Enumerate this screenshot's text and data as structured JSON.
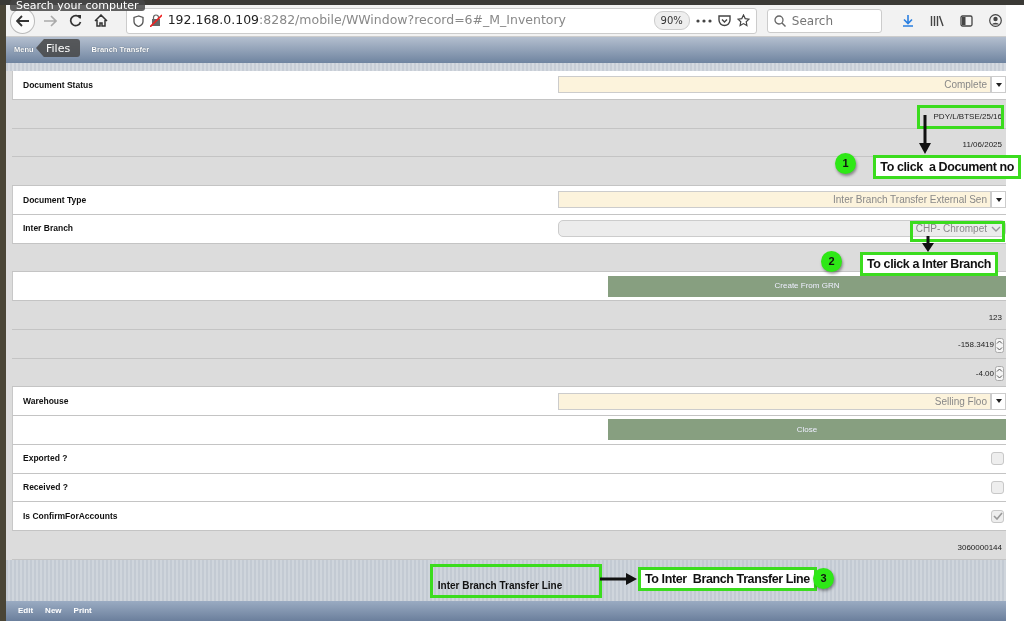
{
  "desktop_tooltips": [
    {
      "text": "Search your computer"
    },
    {
      "text": "Files"
    }
  ],
  "browser": {
    "url_host": "192.168.0.109",
    "url_rest": ":8282/mobile/WWindow?record=6#_M_Inventory",
    "zoom": "90%",
    "search": {
      "placeholder": "Search"
    }
  },
  "header": {
    "breadcrumb": [
      "Menu",
      "Branch Transfer"
    ]
  },
  "rows": [
    {
      "kind": "select",
      "label": "Document Status",
      "value": "Complete",
      "disabled": false
    },
    {
      "kind": "text",
      "value": "PDY/L/BTSE/25/16"
    },
    {
      "kind": "text",
      "value": "11/06/2025"
    },
    {
      "kind": "empty"
    },
    {
      "kind": "select",
      "label": "Document Type",
      "value": "Inter Branch Transfer External Sen",
      "disabled": false
    },
    {
      "kind": "select",
      "label": "Inter Branch",
      "value": "CHP- Chrompet",
      "disabled": true
    },
    {
      "kind": "empty"
    },
    {
      "kind": "button",
      "label": "Create From GRN"
    },
    {
      "kind": "text",
      "value": "123"
    },
    {
      "kind": "number",
      "value": "-158.3419"
    },
    {
      "kind": "number",
      "value": "-4.00"
    },
    {
      "kind": "select",
      "label": "Warehouse",
      "value": "Selling Floo",
      "disabled": false
    },
    {
      "kind": "button",
      "label": "Close"
    },
    {
      "kind": "checkbox",
      "label": "Exported ?",
      "checked": false
    },
    {
      "kind": "checkbox",
      "label": "Received ?",
      "checked": false
    },
    {
      "kind": "checkbox",
      "label": "Is ConfirmForAccounts",
      "checked": true
    },
    {
      "kind": "text",
      "value": "3060000144"
    }
  ],
  "tab": {
    "label": "Inter Branch Transfer Line"
  },
  "footer": {
    "actions": [
      "Edit",
      "New",
      "Print"
    ]
  },
  "annotations": [
    {
      "number": "1",
      "text": "To click  a Document no"
    },
    {
      "number": "2",
      "text": "To click a Inter Branch"
    },
    {
      "number": "3",
      "text": "To Inter  Branch Transfer Line"
    }
  ]
}
